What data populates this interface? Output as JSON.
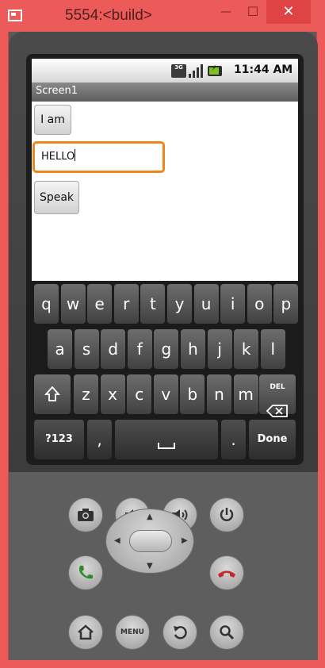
{
  "window": {
    "title": "5554:<build>",
    "minimize": "—",
    "maximize": "☐",
    "close": "✕"
  },
  "statusbar": {
    "network": "3G",
    "time": "11:44 AM"
  },
  "app": {
    "title": "Screen1",
    "button_label": "I am",
    "textbox_value": "HELLO",
    "speak_label": "Speak"
  },
  "keyboard": {
    "row1": [
      "q",
      "w",
      "e",
      "r",
      "t",
      "y",
      "u",
      "i",
      "o",
      "p"
    ],
    "row2": [
      "a",
      "s",
      "d",
      "f",
      "g",
      "h",
      "j",
      "k",
      "l"
    ],
    "row3": [
      "z",
      "x",
      "c",
      "v",
      "b",
      "n",
      "m"
    ],
    "del_label": "DEL",
    "numbers_label": "?123",
    "comma_label": ",",
    "period_label": ".",
    "done_label": "Done"
  },
  "controls": {
    "menu_label": "MENU"
  },
  "colors": {
    "window_frame": "#ec5b59",
    "textbox_focus": "#f0861a",
    "call_green": "#2e8b2e",
    "end_red": "#c62828"
  }
}
